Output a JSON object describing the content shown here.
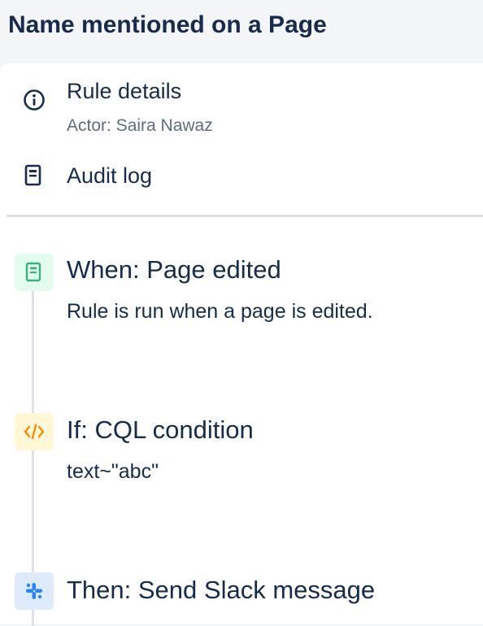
{
  "header": {
    "title": "Name mentioned on a Page"
  },
  "sidebar": {
    "rule_details": {
      "label": "Rule details",
      "actor": "Actor: Saira Nawaz",
      "icon": "info-icon"
    },
    "audit_log": {
      "label": "Audit log",
      "icon": "document-icon"
    }
  },
  "steps": [
    {
      "title": "When: Page edited",
      "description": "Rule is run when a page is edited.",
      "icon": "page-icon",
      "icon_bg": "#e3fcef",
      "icon_color": "#36b37e"
    },
    {
      "title": "If: CQL condition",
      "description": "text~\"abc\"",
      "icon": "code-icon",
      "icon_bg": "#fff7d6",
      "icon_color": "#ff8b00"
    },
    {
      "title": "Then: Send Slack message",
      "description": "",
      "icon": "slack-icon",
      "icon_bg": "#deebff",
      "icon_color": "#2684ff"
    }
  ]
}
